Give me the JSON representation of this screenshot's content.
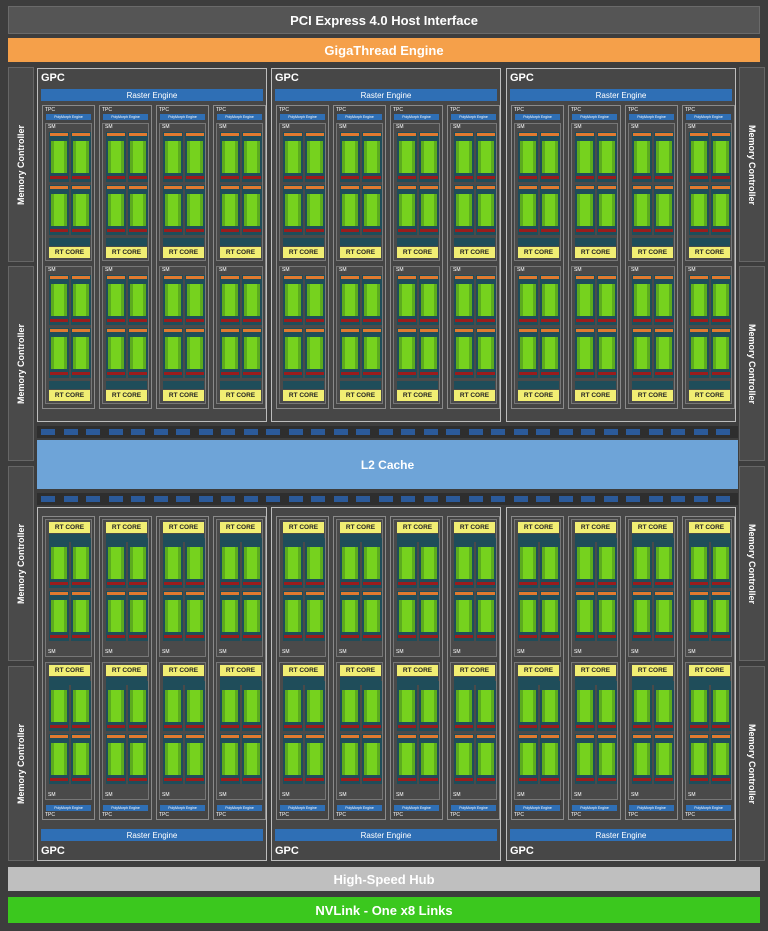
{
  "host_interface": "PCI Express 4.0 Host Interface",
  "gigathread": "GigaThread Engine",
  "memory_controller": "Memory Controller",
  "gpc_label": "GPC",
  "raster_engine": "Raster Engine",
  "tpc_label": "TPC",
  "polymorph": "PolyMorph Engine",
  "sm_label": "SM",
  "rt_core": "RT CORE",
  "l2_cache": "L2 Cache",
  "hub": "High-Speed Hub",
  "nvlink": "NVLink - One x8 Links",
  "colors": {
    "accent_orange": "#f5a04a",
    "nvlink_green": "#3bc81e",
    "raster_blue": "#2f6fb5",
    "rt_yellow": "#f1ee73",
    "l2_blue": "#6ea4d8",
    "core_green": "#5cab1e"
  }
}
